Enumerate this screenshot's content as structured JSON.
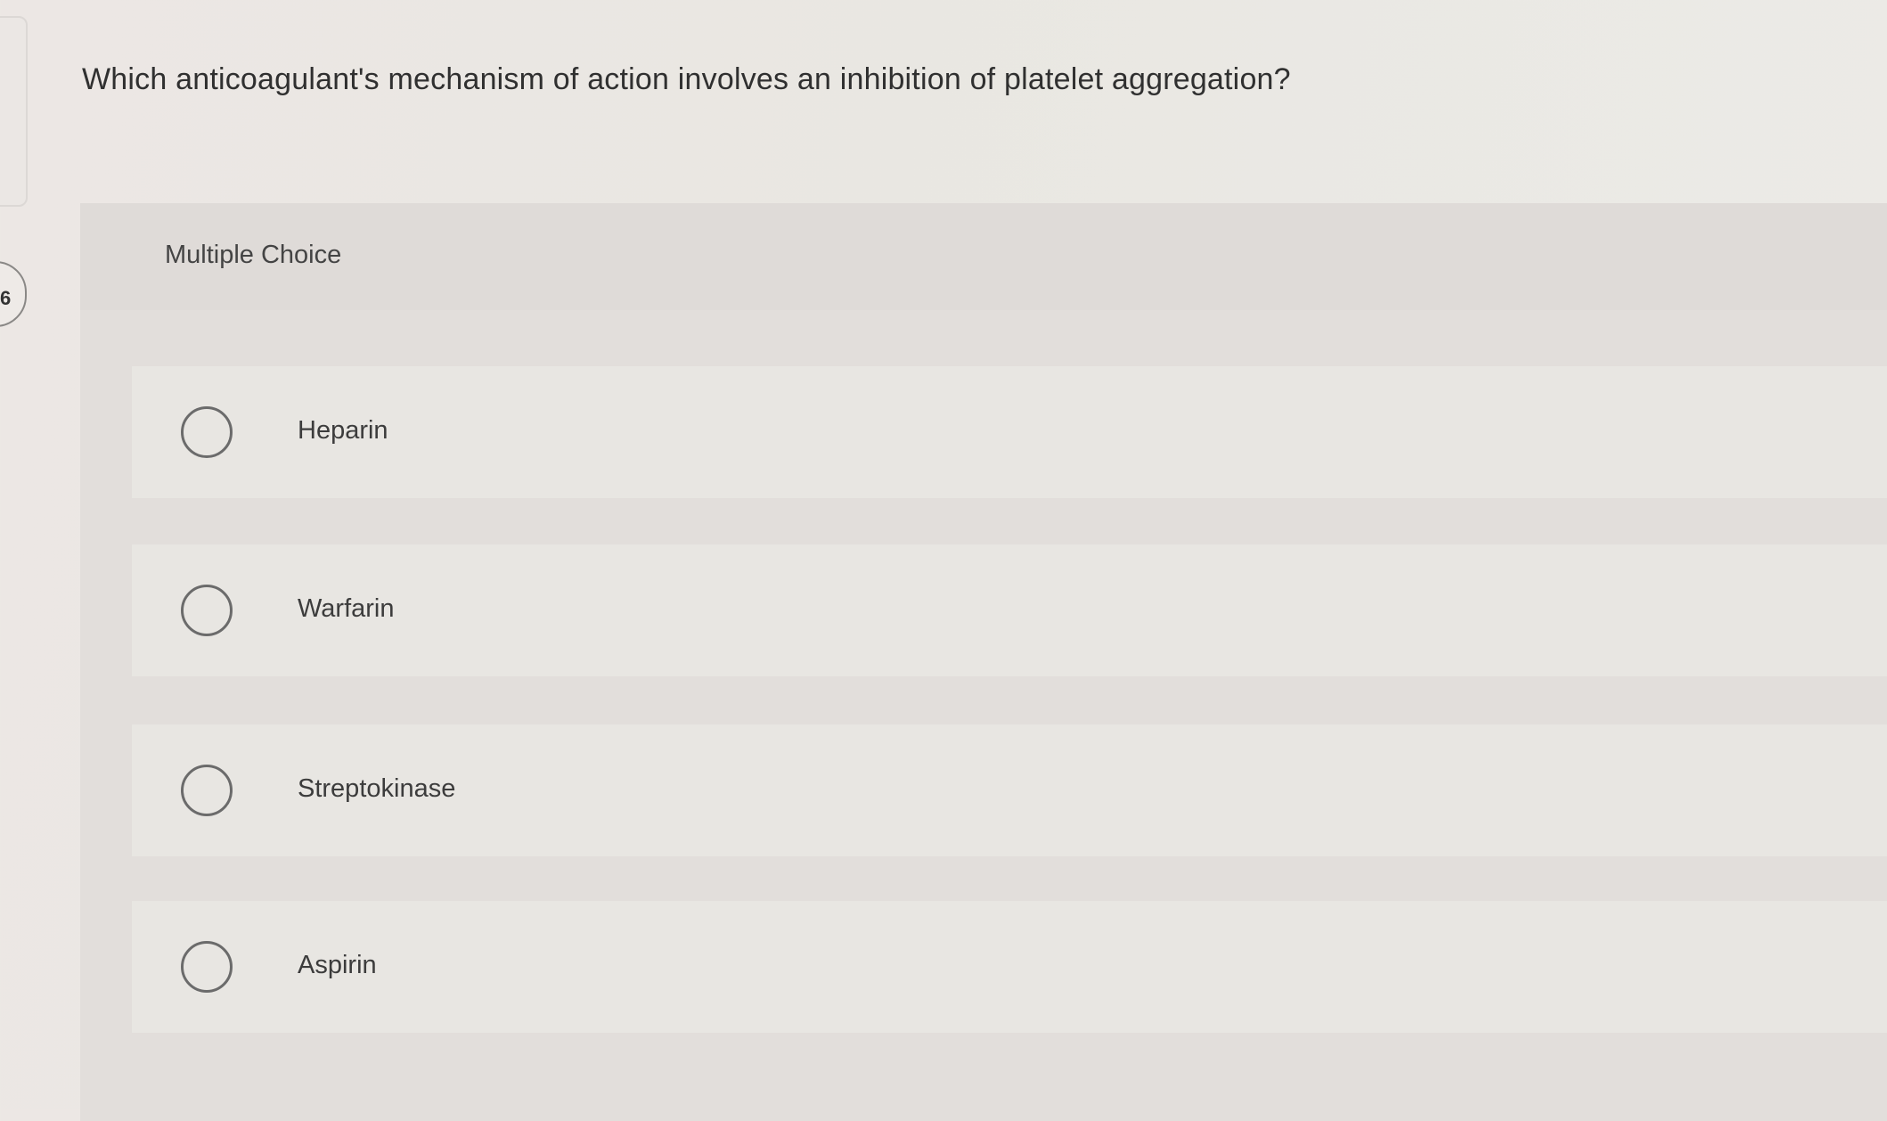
{
  "question": {
    "number": "6",
    "text": "Which anticoagulant's mechanism of action involves an inhibition of platelet aggregation?"
  },
  "answer_section": {
    "type_label": "Multiple Choice",
    "options": [
      {
        "label": "Heparin",
        "selected": false
      },
      {
        "label": "Warfarin",
        "selected": false
      },
      {
        "label": "Streptokinase",
        "selected": false
      },
      {
        "label": "Aspirin",
        "selected": false
      }
    ]
  }
}
